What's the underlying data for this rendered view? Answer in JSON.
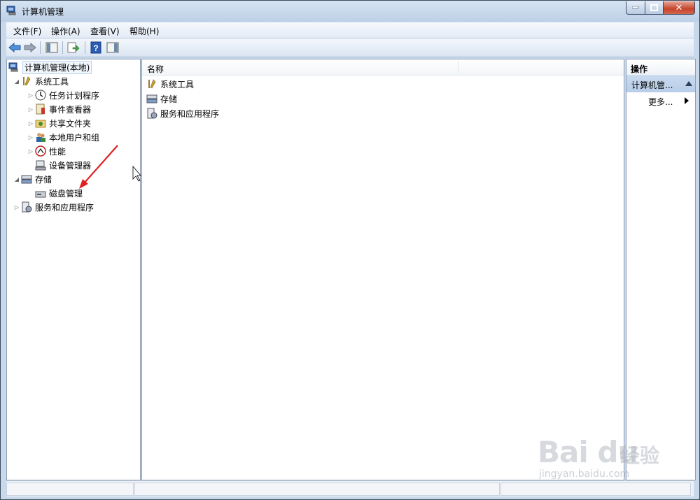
{
  "window": {
    "title": "计算机管理"
  },
  "menu": [
    "文件(F)",
    "操作(A)",
    "查看(V)",
    "帮助(H)"
  ],
  "tree": {
    "root": "计算机管理(本地)",
    "items": [
      {
        "label": "系统工具",
        "icon": "tools-icon"
      },
      {
        "label": "任务计划程序",
        "icon": "clock-icon"
      },
      {
        "label": "事件查看器",
        "icon": "event-viewer-icon"
      },
      {
        "label": "共享文件夹",
        "icon": "shared-folder-icon"
      },
      {
        "label": "本地用户和组",
        "icon": "users-icon"
      },
      {
        "label": "性能",
        "icon": "performance-icon"
      },
      {
        "label": "设备管理器",
        "icon": "device-manager-icon"
      },
      {
        "label": "存储",
        "icon": "storage-icon"
      },
      {
        "label": "磁盘管理",
        "icon": "disk-icon"
      },
      {
        "label": "服务和应用程序",
        "icon": "services-icon"
      }
    ]
  },
  "list": {
    "column_name": "名称",
    "items": [
      "系统工具",
      "存储",
      "服务和应用程序"
    ]
  },
  "actions": {
    "title": "操作",
    "section": "计算机管...",
    "more": "更多..."
  },
  "watermark": {
    "logo": "Bai du",
    "cn": "经验",
    "sub": "jingyan.baidu.com"
  }
}
